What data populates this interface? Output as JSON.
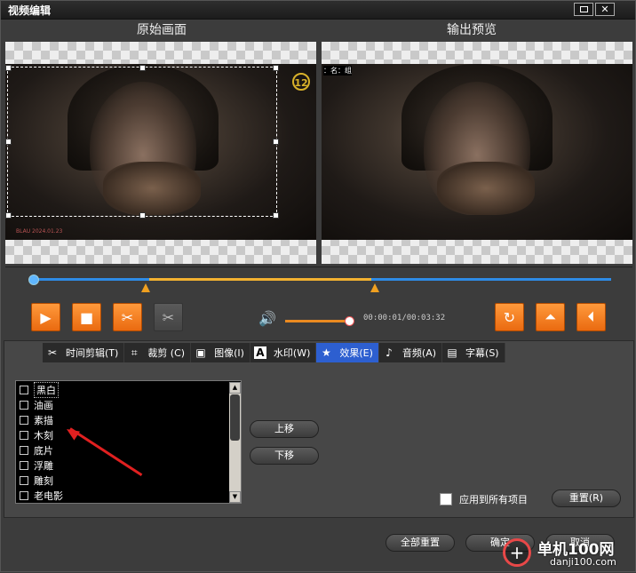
{
  "window": {
    "title": "视频编辑"
  },
  "panels": {
    "original_label": "原始画面",
    "output_label": "输出预览"
  },
  "preview": {
    "badge": "12",
    "overlay_text": "BLAU  2024.01.23",
    "output_caption": "：名：组"
  },
  "player": {
    "timecode": "00:00:01/00:03:32"
  },
  "tabs": [
    {
      "label": "时间剪辑(T)",
      "icon": "scissors-icon"
    },
    {
      "label": "裁剪 (C)",
      "icon": "crop-icon"
    },
    {
      "label": "图像(I)",
      "icon": "image-icon"
    },
    {
      "label": "水印(W)",
      "icon": "watermark-icon"
    },
    {
      "label": "效果(E)",
      "icon": "star-icon",
      "active": true
    },
    {
      "label": "音频(A)",
      "icon": "music-note-icon"
    },
    {
      "label": "字幕(S)",
      "icon": "subtitle-icon"
    }
  ],
  "effects": {
    "items": [
      "黑白",
      "油画",
      "素描",
      "木刻",
      "底片",
      "浮雕",
      "雕刻",
      "老电影"
    ],
    "move_up": "上移",
    "move_down": "下移",
    "apply_all": "应用到所有项目",
    "reset": "重置(R)"
  },
  "footer": {
    "reset_all": "全部重置",
    "ok": "确定",
    "cancel": "取消"
  },
  "site_watermark": {
    "name": "单机100网",
    "url": "danji100.com"
  },
  "colors": {
    "accent_orange": "#ea6a10",
    "timeline_blue": "#2e8be6",
    "selection_yellow": "#f3b230",
    "active_tab": "#2d5fd0"
  }
}
